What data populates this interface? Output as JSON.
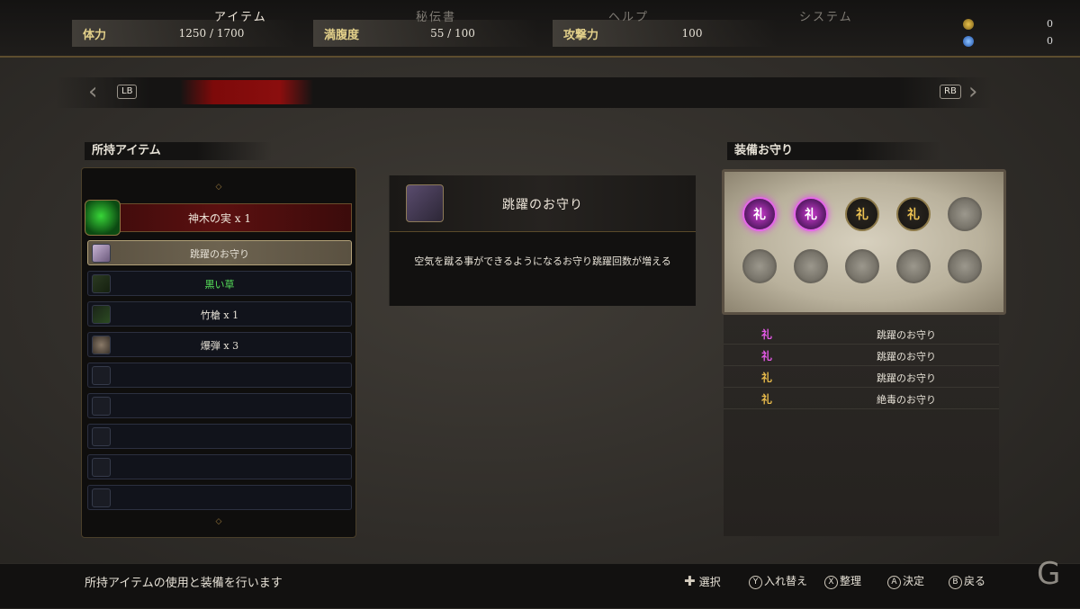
{
  "stats": [
    {
      "label": "体力",
      "value": "1250 / 1700"
    },
    {
      "label": "満腹度",
      "value": "55 / 100"
    },
    {
      "label": "攻撃力",
      "value": "100"
    }
  ],
  "currencies": [
    {
      "icon": "coin-icon",
      "value": "0",
      "color": "#c9a53a"
    },
    {
      "icon": "spirit-orb-icon",
      "value": "0",
      "color": "#3a7be0"
    }
  ],
  "tabs": {
    "left_button": "LB",
    "right_button": "RB",
    "items": [
      "アイテム",
      "秘伝書",
      "ヘルプ",
      "システム"
    ],
    "active": "アイテム"
  },
  "inventory": {
    "title": "所持アイテム",
    "featured": "神木の実 x 1",
    "slots": [
      "跳躍のお守り",
      "黒い草",
      "竹槍 x 1",
      "爆弾 x 3",
      "",
      "",
      "",
      "",
      ""
    ]
  },
  "detail": {
    "name": "跳躍のお守り",
    "description": "空気を蹴る事ができるようになるお守り跳躍回数が増える"
  },
  "equipped": {
    "title": "装備お守り",
    "glyph": "礼",
    "list": [
      "跳躍のお守り",
      "跳躍のお守り",
      "跳躍のお守り",
      "絶毒のお守り"
    ]
  },
  "footer": {
    "help": "所持アイテムの使用と装備を行います",
    "hints": [
      {
        "key": "✚",
        "label": "選択"
      },
      {
        "key": "Y",
        "label": "入れ替え"
      },
      {
        "key": "X",
        "label": "整理"
      },
      {
        "key": "A",
        "label": "決定"
      },
      {
        "key": "B",
        "label": "戻る"
      }
    ]
  },
  "watermark": "G"
}
